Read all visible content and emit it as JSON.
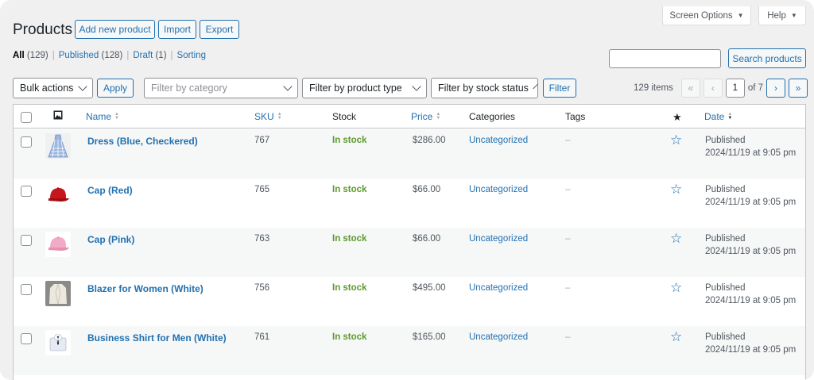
{
  "header": {
    "title": "Products",
    "add_new_label": "Add new product",
    "import_label": "Import",
    "export_label": "Export",
    "screen_options_label": "Screen Options",
    "help_label": "Help"
  },
  "views": {
    "all_label": "All",
    "all_count": "(129)",
    "published_label": "Published",
    "published_count": "(128)",
    "draft_label": "Draft",
    "draft_count": "(1)",
    "sorting_label": "Sorting",
    "separator": "|"
  },
  "search": {
    "value": "",
    "button_label": "Search products"
  },
  "filters": {
    "bulk_actions": "Bulk actions",
    "apply_label": "Apply",
    "category_placeholder": "Filter by category",
    "product_type": "Filter by product type",
    "stock_status": "Filter by stock status",
    "filter_label": "Filter"
  },
  "pagination": {
    "items_text": "129 items",
    "first": "«",
    "prev": "‹",
    "current_page": "1",
    "of_text": "of 7",
    "next": "›",
    "last": "»"
  },
  "table": {
    "columns": {
      "thumb_icon": "image-icon",
      "name": "Name",
      "sku": "SKU",
      "stock": "Stock",
      "price": "Price",
      "categories": "Categories",
      "tags": "Tags",
      "featured_icon": "star-filled-icon",
      "date": "Date"
    },
    "rows": [
      {
        "thumb": "dress-icon",
        "name": "Dress (Blue, Checkered)",
        "sku": "767",
        "stock": "In stock",
        "price": "$286.00",
        "category": "Uncategorized",
        "tags": "–",
        "featured_icon": "star-outline-icon",
        "status": "Published",
        "date": "2024/11/19 at 9:05 pm"
      },
      {
        "thumb": "cap-red-icon",
        "name": "Cap (Red)",
        "sku": "765",
        "stock": "In stock",
        "price": "$66.00",
        "category": "Uncategorized",
        "tags": "–",
        "featured_icon": "star-outline-icon",
        "status": "Published",
        "date": "2024/11/19 at 9:05 pm"
      },
      {
        "thumb": "cap-pink-icon",
        "name": "Cap (Pink)",
        "sku": "763",
        "stock": "In stock",
        "price": "$66.00",
        "category": "Uncategorized",
        "tags": "–",
        "featured_icon": "star-outline-icon",
        "status": "Published",
        "date": "2024/11/19 at 9:05 pm"
      },
      {
        "thumb": "blazer-icon",
        "name": "Blazer for Women (White)",
        "sku": "756",
        "stock": "In stock",
        "price": "$495.00",
        "category": "Uncategorized",
        "tags": "–",
        "featured_icon": "star-outline-icon",
        "status": "Published",
        "date": "2024/11/19 at 9:05 pm"
      },
      {
        "thumb": "shirt-icon",
        "name": "Business Shirt for Men (White)",
        "sku": "761",
        "stock": "In stock",
        "price": "$165.00",
        "category": "Uncategorized",
        "tags": "–",
        "featured_icon": "star-outline-icon",
        "status": "Published",
        "date": "2024/11/19 at 9:05 pm"
      }
    ]
  },
  "colors": {
    "accent": "#2271b1",
    "in_stock": "#5b9a2c",
    "background": "#f0f0f1"
  }
}
